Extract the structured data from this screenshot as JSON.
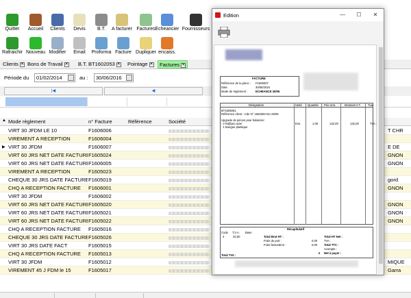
{
  "toolbar": {
    "row1": [
      {
        "name": "quit-button",
        "label": "Quitter",
        "icon": "power-icon",
        "color": "#2e9a2e"
      },
      {
        "name": "accueil-button",
        "label": "Accueil",
        "icon": "house-icon",
        "color": "#a05a2c"
      },
      {
        "name": "clients-button",
        "label": "Clients",
        "icon": "people-icon",
        "color": "#4a6aa8"
      },
      {
        "name": "devis-button",
        "label": "Devis",
        "icon": "document-pencil-icon",
        "color": "#e8e0b8"
      },
      {
        "name": "bt-button",
        "label": "B.T.",
        "icon": "gear-icon",
        "color": "#8c8c8c"
      },
      {
        "name": "a-facturer-button",
        "label": "A facturer",
        "icon": "invoice-pending-icon",
        "color": "#d9c37a"
      },
      {
        "name": "factures-button",
        "label": "Factures",
        "icon": "invoice-icon",
        "color": "#8fc48f"
      },
      {
        "name": "echeancier-button",
        "label": "Echeancier",
        "icon": "schedule-arrow-icon",
        "color": "#5a8fd8"
      },
      {
        "name": "fournisseurs-button",
        "label": "Fournisseurs",
        "icon": "supplier-icon",
        "color": "#333333"
      }
    ],
    "row2": [
      {
        "name": "refresh-button",
        "label": "Rafraichir",
        "icon": "refresh-icon",
        "color": "#2e9a2e"
      },
      {
        "name": "new-button",
        "label": "Nouveau",
        "icon": "plus-icon",
        "color": "#2eb82e"
      },
      {
        "name": "modify-button",
        "label": "Modifier",
        "icon": "magnifier-icon",
        "color": "#9ab0c8"
      },
      {
        "name": "email-button",
        "label": "Email",
        "icon": "email-icon",
        "color": "#c0c0c0"
      },
      {
        "name": "proforma-button",
        "label": "Proforma",
        "icon": "printer-icon",
        "color": "#6aa0d0"
      },
      {
        "name": "facture-button",
        "label": "Facture",
        "icon": "printer-icon",
        "color": "#6aa0d0"
      },
      {
        "name": "dupliquer-button",
        "label": "Dupliquer",
        "icon": "duplicate-icon",
        "color": "#e8d27a"
      },
      {
        "name": "encaiss-button",
        "label": "encaiss.",
        "icon": "payment-icon",
        "color": "#e07a2a"
      }
    ]
  },
  "tabs": [
    {
      "name": "tab-clients",
      "label": "Clients",
      "active": false
    },
    {
      "name": "tab-bons-de-travail",
      "label": "Bons de Travail",
      "active": false
    },
    {
      "name": "tab-bt",
      "label": "B.T. BT1602053",
      "active": false
    },
    {
      "name": "tab-pointage",
      "label": "Pointage",
      "active": false
    },
    {
      "name": "tab-factures",
      "label": "Factures",
      "active": true
    }
  ],
  "period": {
    "label": "Période du",
    "from": "01/02/2014",
    "to_label": "au :",
    "to": "30/06/2016"
  },
  "grid": {
    "headers": {
      "mode": "Mode règlement",
      "num": "n° Facture",
      "ref": "Référence",
      "societe": "Société"
    },
    "rows": [
      {
        "mode": "VIRT 30 JFDM LE 10",
        "num": "F1606006",
        "right": "T CHR"
      },
      {
        "mode": "VIREMENT A RECEPTION",
        "num": "F1606004",
        "right": ""
      },
      {
        "mode": "VIRT 30 JFDM",
        "num": "F1606007",
        "right": "E DE",
        "current": true
      },
      {
        "mode": "VIRT 60 JRS NET DATE FACTURE",
        "num": "F1605024",
        "right": "GNON"
      },
      {
        "mode": "VIRT 60 JRS NET DATE FACTURE",
        "num": "F1606005",
        "right": "GNON"
      },
      {
        "mode": "VIREMENT A RECEPTION",
        "num": "F1605023",
        "right": ""
      },
      {
        "mode": "CHEQUE 30 JRS DATE FACTURE",
        "num": "F1605019",
        "right": "gord"
      },
      {
        "mode": "CHQ A RECEPTION FACTURE",
        "num": "F1606001",
        "right": "GNON"
      },
      {
        "mode": "VIRT 30 JFDM",
        "num": "F1606002",
        "right": ""
      },
      {
        "mode": "VIRT 60 JRS NET DATE FACTURE",
        "num": "F1605020",
        "right": "GNON"
      },
      {
        "mode": "VIRT 60 JRS NET DATE FACTURE",
        "num": "F1605021",
        "right": "GNON"
      },
      {
        "mode": "VIRT 60 JRS NET DATE FACTURE",
        "num": "F1605022",
        "right": "GNON"
      },
      {
        "mode": "CHQ A RECEPTION FACTURE",
        "num": "F1605016",
        "right": ""
      },
      {
        "mode": "CHEQUE 30 JRS DATE FACTURE",
        "num": "F1605026",
        "right": ""
      },
      {
        "mode": "VIRT 30 JRS DATE FACT",
        "num": "F1605015",
        "right": ""
      },
      {
        "mode": "CHQ A RECEPTION FACTURE",
        "num": "F1605013",
        "right": ""
      },
      {
        "mode": "VIRT 30 JFDM",
        "num": "F1605012",
        "right": "MIQUE"
      },
      {
        "mode": "VIREMENT 45 J FDM le 15",
        "num": "F1605017",
        "right": "Garra"
      }
    ]
  },
  "edition": {
    "title": "Edition",
    "doc": {
      "header": "FACTURE",
      "ref_label": "Référence de la pièce :",
      "ref_value": "F1606007",
      "date_label": "Date",
      "date_value": "30/06/2016",
      "mode_label": "Mode de règlement :",
      "mode_value": "ECHEANCE 30/06",
      "col_designation": "Désignation",
      "col_unite": "Unité",
      "col_quantite": "Quantité",
      "col_prix": "Prix Unit.",
      "col_montant": "Montant H.T.",
      "col_tva": "Tva",
      "line1": "BT1605061",
      "line2": "Référence client : Cde N° 1583283 DU 25/05",
      "line3": "Upgrade de pièces pour balancier",
      "line4": "- 2 Ralfpeo acier",
      "line5": "- 1 Buégue plastique",
      "unite": "Ens.",
      "quantite": "1,00",
      "prix": "132,00",
      "montant": "132,00",
      "tva": "TVA :",
      "recap": "Récapitulatif",
      "code_label": "Code",
      "taux_label": "T.V.A.",
      "base_label": "Base",
      "code": "4",
      "taux": "20,00",
      "total_brut": "Total Brut HT :",
      "frais_port": "Frais de port :",
      "frais_fact": "Frais facturation :",
      "frais_port_val": "0,00",
      "frais_fact_val": "0,00",
      "total_ht": "Total HT Net :",
      "total_ttc": "Total TTC :",
      "acompte": "Acompte :",
      "net_payer": "Net à payer :",
      "euro": "€",
      "total_tva": "Total TVA :"
    }
  }
}
